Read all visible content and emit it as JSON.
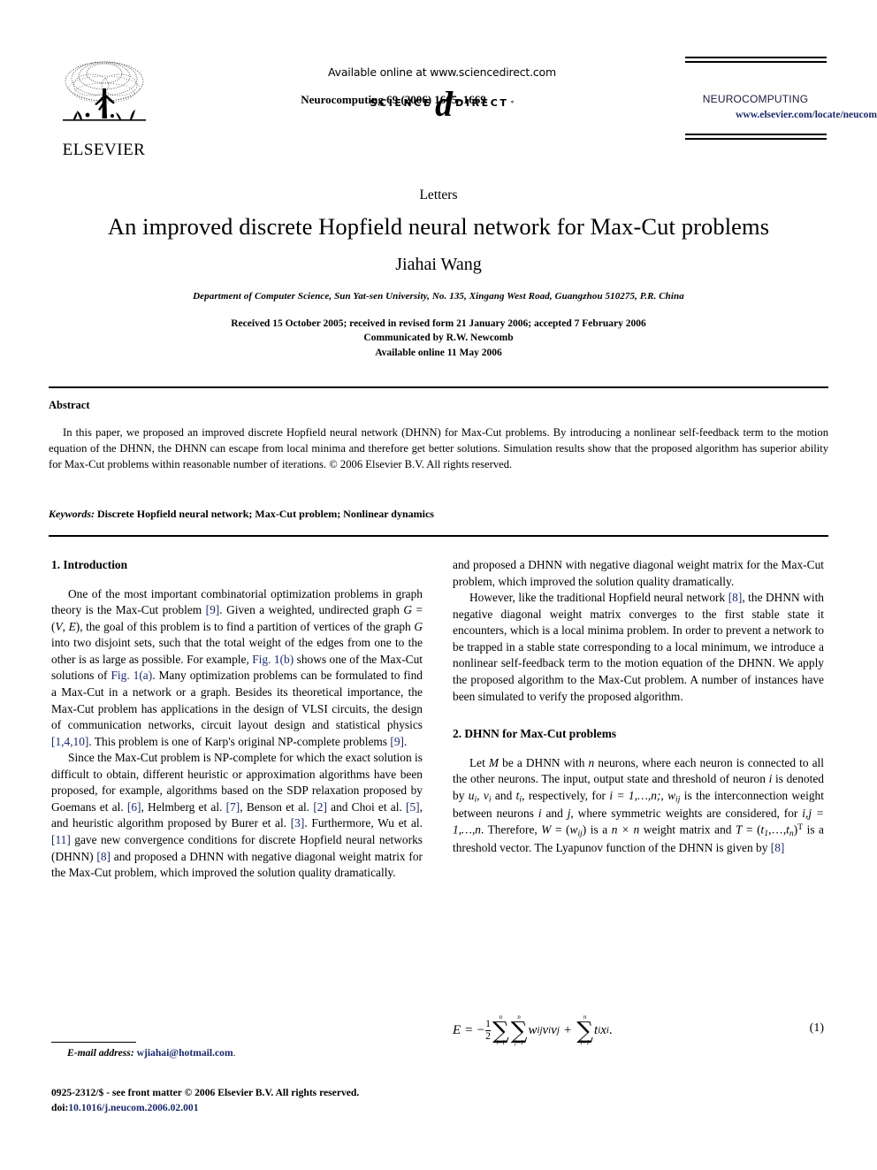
{
  "header": {
    "available_online": "Available online at www.sciencedirect.com",
    "sciencedirect_left": "SCIENCE",
    "sciencedirect_right": "DIRECT",
    "sciencedirect_star": "*",
    "publisher_name": "ELSEVIER",
    "journal_reference": "Neurocomputing 69 (2006) 1665–1669",
    "journal_name": "NEUROCOMPUTING",
    "journal_url": "www.elsevier.com/locate/neucom"
  },
  "title_block": {
    "section_label": "Letters",
    "title": "An improved discrete Hopfield neural network for Max-Cut problems",
    "author": "Jiahai Wang",
    "affiliation": "Department of Computer Science, Sun Yat-sen University, No. 135, Xingang West Road, Guangzhou 510275, P.R. China",
    "history_line1": "Received 15 October 2005; received in revised form 21 January 2006; accepted 7 February 2006",
    "history_line2": "Communicated by R.W. Newcomb",
    "history_line3": "Available online 11 May 2006"
  },
  "abstract": {
    "heading": "Abstract",
    "body": "In this paper, we proposed an improved discrete Hopfield neural network (DHNN) for Max-Cut problems. By introducing a nonlinear self-feedback term to the motion equation of the DHNN, the DHNN can escape from local minima and therefore get better solutions. Simulation results show that the proposed algorithm has superior ability for Max-Cut problems within reasonable number of iterations. © 2006 Elsevier B.V. All rights reserved.",
    "keywords_label": "Keywords:",
    "keywords_value": "Discrete Hopfield neural network; Max-Cut problem; Nonlinear dynamics"
  },
  "sections": {
    "intro_heading": "1.  Introduction",
    "dhnn_heading": "2.  DHNN for Max-Cut problems"
  },
  "body_text": {
    "intro_p1_a": "One of the most important combinatorial optimization problems in graph theory is the Max-Cut problem ",
    "intro_p1_ref9a": "[9]",
    "intro_p1_b": ". Given a weighted, undirected graph ",
    "intro_p1_g": "G",
    "intro_p1_eq": " = (",
    "intro_p1_v": "V",
    "intro_p1_comma": ", ",
    "intro_p1_e": "E",
    "intro_p1_c": "), the goal of this problem is to find a partition of vertices of the graph ",
    "intro_p1_g2": "G",
    "intro_p1_d": " into two disjoint sets, such that the total weight of the edges from one to the other is as large as possible. For example, ",
    "intro_p1_fig1b": "Fig. 1(b)",
    "intro_p1_e2": " shows one of the Max-Cut solutions of ",
    "intro_p1_fig1a": "Fig. 1(a)",
    "intro_p1_f": ". Many optimization problems can be formulated to find a Max-Cut in a network or a graph. Besides its theoretical importance, the Max-Cut problem has applications in the design of VLSI circuits, the design of communication networks, circuit layout design and statistical physics ",
    "intro_p1_ref1410": "[1,4,10]",
    "intro_p1_g3": ". This problem is one of Karp's original NP-complete problems ",
    "intro_p1_ref9b": "[9]",
    "intro_p1_end": ".",
    "intro_p2_a": "Since the Max-Cut problem is NP-complete for which the exact solution is difficult to obtain, different heuristic or approximation algorithms have been proposed, for example, algorithms based on the SDP relaxation proposed by Goemans et al. ",
    "intro_p2_ref6": "[6]",
    "intro_p2_b": ", Helmberg et al. ",
    "intro_p2_ref7": "[7]",
    "intro_p2_c": ", Benson et al. ",
    "intro_p2_ref2": "[2]",
    "intro_p2_d": " and Choi et al. ",
    "intro_p2_ref5": "[5]",
    "intro_p2_e": ", and heuristic algorithm proposed by Burer et al. ",
    "intro_p2_ref3": "[3]",
    "intro_p2_f": ". Furthermore, Wu et al. ",
    "intro_p2_ref11": "[11]",
    "intro_p2_g": " gave new convergence conditions for discrete Hopfield neural networks (DHNN) ",
    "intro_p2_ref8": "[8]",
    "intro_p2_h": " and proposed a DHNN with negative diagonal weight matrix for the Max-Cut problem, which improved the solution quality dramatically.",
    "intro_p3_a": "However, like the traditional Hopfield neural network ",
    "intro_p3_ref8": "[8]",
    "intro_p3_b": ", the DHNN with negative diagonal weight matrix converges to the first stable state it encounters, which is a local minima problem. In order to prevent a network to be trapped in a stable state corresponding to a local minimum, we introduce a nonlinear self-feedback term to the motion equation of the DHNN. We apply the proposed algorithm to the Max-Cut problem. A number of instances have been simulated to verify the proposed algorithm.",
    "dhnn_p1_a": "Let ",
    "dhnn_p1_M": "M",
    "dhnn_p1_b": " be a DHNN with ",
    "dhnn_p1_n": "n",
    "dhnn_p1_c": " neurons, where each neuron is connected to all the other neurons. The input, output state and threshold of neuron ",
    "dhnn_p1_i": "i",
    "dhnn_p1_d": " is denoted by ",
    "dhnn_p1_u": "u",
    "dhnn_p1_ui": "i",
    "dhnn_p1_e": ", ",
    "dhnn_p1_v": "v",
    "dhnn_p1_vi": "i",
    "dhnn_p1_f": " and ",
    "dhnn_p1_t": "t",
    "dhnn_p1_ti": "i",
    "dhnn_p1_g": ", respectively, for  ",
    "dhnn_p1_irange": "i = 1,…,n;",
    "dhnn_p1_w": "w",
    "dhnn_p1_wij": "ij",
    "dhnn_p1_h": " is the interconnection weight between neurons ",
    "dhnn_p1_i2": "i",
    "dhnn_p1_j": " and ",
    "dhnn_p1_j2": "j",
    "dhnn_p1_k": ", where symmetric weights are considered, for ",
    "dhnn_p1_ijrange": "i,j = 1,…,n",
    "dhnn_p1_l": ". Therefore, ",
    "dhnn_p1_W": "W",
    "dhnn_p1_Weq": " = (",
    "dhnn_p1_wij2": "w",
    "dhnn_p1_wij2s": "ij",
    "dhnn_p1_m": ") is a ",
    "dhnn_p1_nxn": "n × n",
    "dhnn_p1_o": " weight matrix and ",
    "dhnn_p1_T": "T",
    "dhnn_p1_Teq": " = (",
    "dhnn_p1_t1": "t",
    "dhnn_p1_t1s": "1",
    "dhnn_p1_dots": ",…,",
    "dhnn_p1_tn": "t",
    "dhnn_p1_tns": "n",
    "dhnn_p1_Tsup": ")",
    "dhnn_p1_Tsups": "T",
    "dhnn_p1_p": " is a threshold vector. The Lyapunov function of the DHNN is given by ",
    "dhnn_p1_ref8": "[8]"
  },
  "equation": {
    "lhs": "E",
    "equals": "=",
    "minus": "−",
    "frac_num": "1",
    "frac_den": "2",
    "sum1_top": "n",
    "sum1_sigma": "∑",
    "sum1_bot": "i=1",
    "sum2_top": "n",
    "sum2_sigma": "∑",
    "sum2_bot": "j=1",
    "term1_w": "w",
    "term1_wsub": "ij",
    "term1_v1": "v",
    "term1_v1sub": "i",
    "term1_v2": "v",
    "term1_v2sub": "j",
    "plus": "+",
    "sum3_top": "n",
    "sum3_sigma": "∑",
    "sum3_bot": "i=1",
    "term2_t": "t",
    "term2_tsub": "i",
    "term2_x": "x",
    "term2_xsub": "i",
    "period": ".",
    "number": "(1)"
  },
  "footer": {
    "email_label": "E-mail address:",
    "email_address": "wjiahai@hotmail.com",
    "email_period": ".",
    "imprint_line": "0925-2312/$ - see front matter © 2006 Elsevier B.V. All rights reserved.",
    "doi_label": "doi:",
    "doi_value": "10.1016/j.neucom.2006.02.001"
  },
  "colors": {
    "link_blue": "#1b2a6b",
    "text_black": "#000000",
    "page_background": "#ffffff"
  }
}
